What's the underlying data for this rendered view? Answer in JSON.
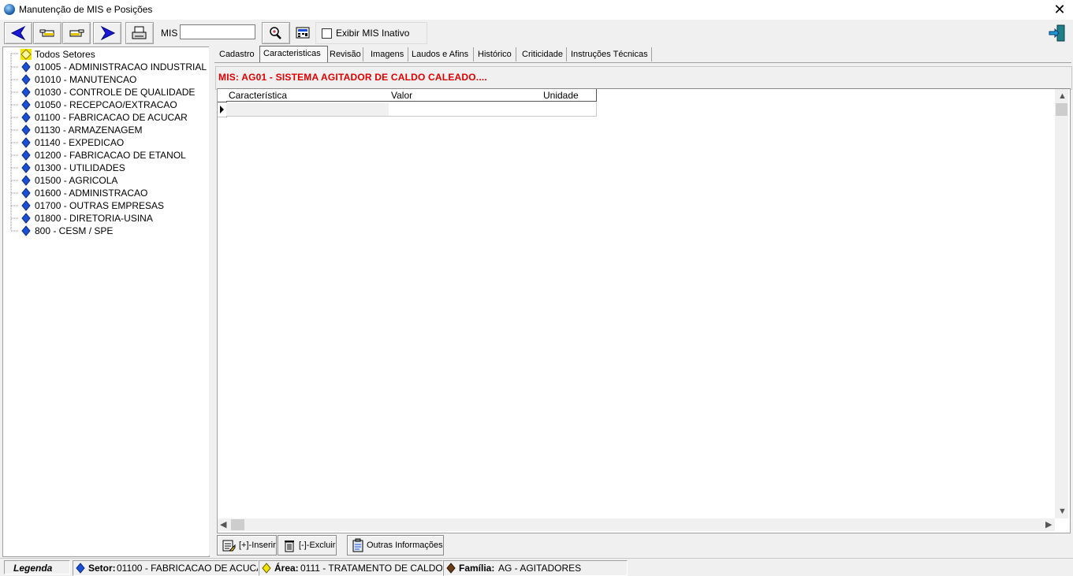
{
  "window": {
    "title": "Manutenção de MIS e Posições",
    "close_glyph": "✕"
  },
  "toolbar": {
    "buttons": [
      {
        "name": "first-record-button",
        "icon": "arrow-left-icon"
      },
      {
        "name": "previous-record-button",
        "icon": "hand-left-icon"
      },
      {
        "name": "next-record-button",
        "icon": "hand-right-icon"
      },
      {
        "name": "last-record-button",
        "icon": "arrow-right-icon"
      },
      {
        "name": "print-button",
        "icon": "printer-icon"
      }
    ],
    "mis_label": "MIS",
    "mis_value": "",
    "search_icon": "magnifier-icon",
    "calculator_icon": "calculator-icon",
    "exibir_inativo_label": "Exibir MIS Inativo",
    "exibir_inativo_checked": false,
    "exit_icon": "exit-door-icon"
  },
  "tree": {
    "root": "Todos Setores",
    "items": [
      "01005 - ADMINISTRACAO INDUSTRIAL",
      "01010 - MANUTENCAO",
      "01030 - CONTROLE DE QUALIDADE",
      "01050 - RECEPCAO/EXTRACAO",
      "01100 - FABRICACAO DE ACUCAR",
      "01130 - ARMAZENAGEM",
      "01140 - EXPEDICAO",
      "01200 - FABRICACAO DE ETANOL",
      "01300 - UTILIDADES",
      "01500 - AGRICOLA",
      "01600 - ADMINISTRACAO",
      "01700 - OUTRAS EMPRESAS",
      "01800 - DIRETORIA-USINA",
      "800 - CESM / SPE"
    ]
  },
  "tabs": [
    "Cadastro",
    "Caracteristicas",
    "Revisão",
    "Imagens",
    "Laudos e Afins",
    "Histórico",
    "Criticidade",
    "Instruções Técnicas"
  ],
  "active_tab": "Caracteristicas",
  "mis_title": "MIS: AG01 - SISTEMA AGITADOR DE CALDO CALEADO....",
  "grid": {
    "columns": [
      "Característica",
      "Valor",
      "Unidade"
    ],
    "rows": [
      [
        "",
        "",
        ""
      ]
    ]
  },
  "buttons": {
    "inserir": "[+]-Inserir",
    "excluir": "[-]-Excluir",
    "outras": "Outras Informações"
  },
  "status": {
    "legenda": "Legenda",
    "setor_label": "Setor:",
    "setor_value": "01100 - FABRICACAO DE ACUCA",
    "area_label": "Área:",
    "area_value": "0111 - TRATAMENTO DE CALDO",
    "familia_label": "Família:",
    "familia_value": "AG - AGITADORES"
  },
  "colors": {
    "accent_red": "#e00000",
    "tree_blue": "#1a4fd6",
    "root_yellow": "#f2e600",
    "familia_brown": "#6b3a16"
  }
}
